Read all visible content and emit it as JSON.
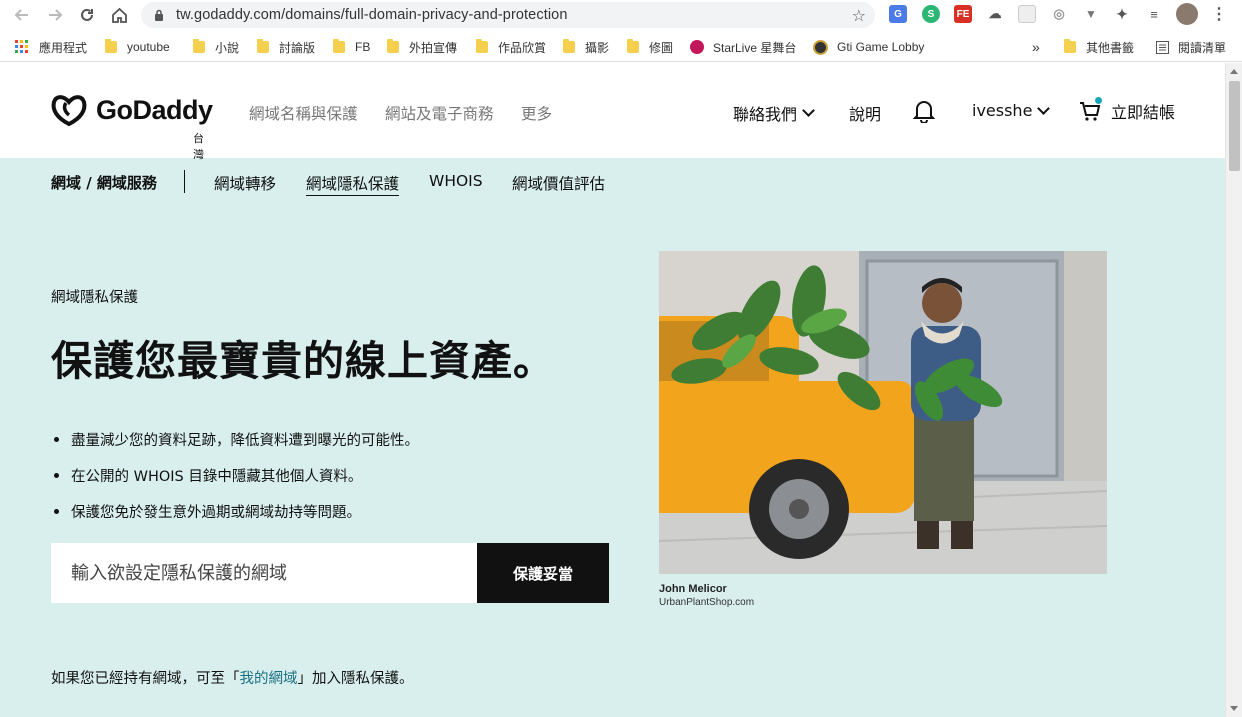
{
  "browser": {
    "url": "tw.godaddy.com/domains/full-domain-privacy-and-protection",
    "bookmarks": [
      {
        "label": "應用程式",
        "type": "apps"
      },
      {
        "label": "youtube",
        "type": "folder"
      },
      {
        "label": "小說",
        "type": "folder"
      },
      {
        "label": "討論版",
        "type": "folder"
      },
      {
        "label": "FB",
        "type": "folder"
      },
      {
        "label": "外拍宣傳",
        "type": "folder"
      },
      {
        "label": "作品欣賞",
        "type": "folder"
      },
      {
        "label": "攝影",
        "type": "folder"
      },
      {
        "label": "修圖",
        "type": "folder"
      },
      {
        "label": "StarLive 星舞台",
        "type": "site"
      },
      {
        "label": "Gti Game Lobby",
        "type": "site"
      }
    ],
    "overflow": "»",
    "other_bookmarks": "其他書籤",
    "reading_list": "閱讀清單"
  },
  "header": {
    "logo_text": "GoDaddy",
    "region": "台灣",
    "nav_left": [
      "網域名稱與保護",
      "網站及電子商務",
      "更多"
    ],
    "contact": "聯絡我們",
    "help": "說明",
    "username": "ivesshe",
    "checkout": "立即結帳"
  },
  "subnav": {
    "title": "網域 / 網域服務",
    "items": [
      "網域轉移",
      "網域隱私保護",
      "WHOIS",
      "網域價值評估"
    ],
    "active_index": 1
  },
  "hero": {
    "eyebrow": "網域隱私保護",
    "headline": "保護您最寶貴的線上資產。",
    "bullets": [
      "盡量減少您的資料足跡，降低資料遭到曝光的可能性。",
      "在公開的 WHOIS 目錄中隱藏其他個人資料。",
      "保護您免於發生意外過期或網域劫持等問題。"
    ],
    "search_placeholder": "輸入欲設定隱私保護的網域",
    "button": "保護妥當",
    "note_before": "如果您已經持有網域，可至「",
    "note_link": "我的網域",
    "note_after": "」加入隱私保護。"
  },
  "photo": {
    "caption_name": "John Melicor",
    "caption_site": "UrbanPlantShop.com"
  },
  "colors": {
    "page_bg": "#d9efee",
    "button_bg": "#111111",
    "link": "#1b6f80",
    "truck": "#f2a51c"
  }
}
